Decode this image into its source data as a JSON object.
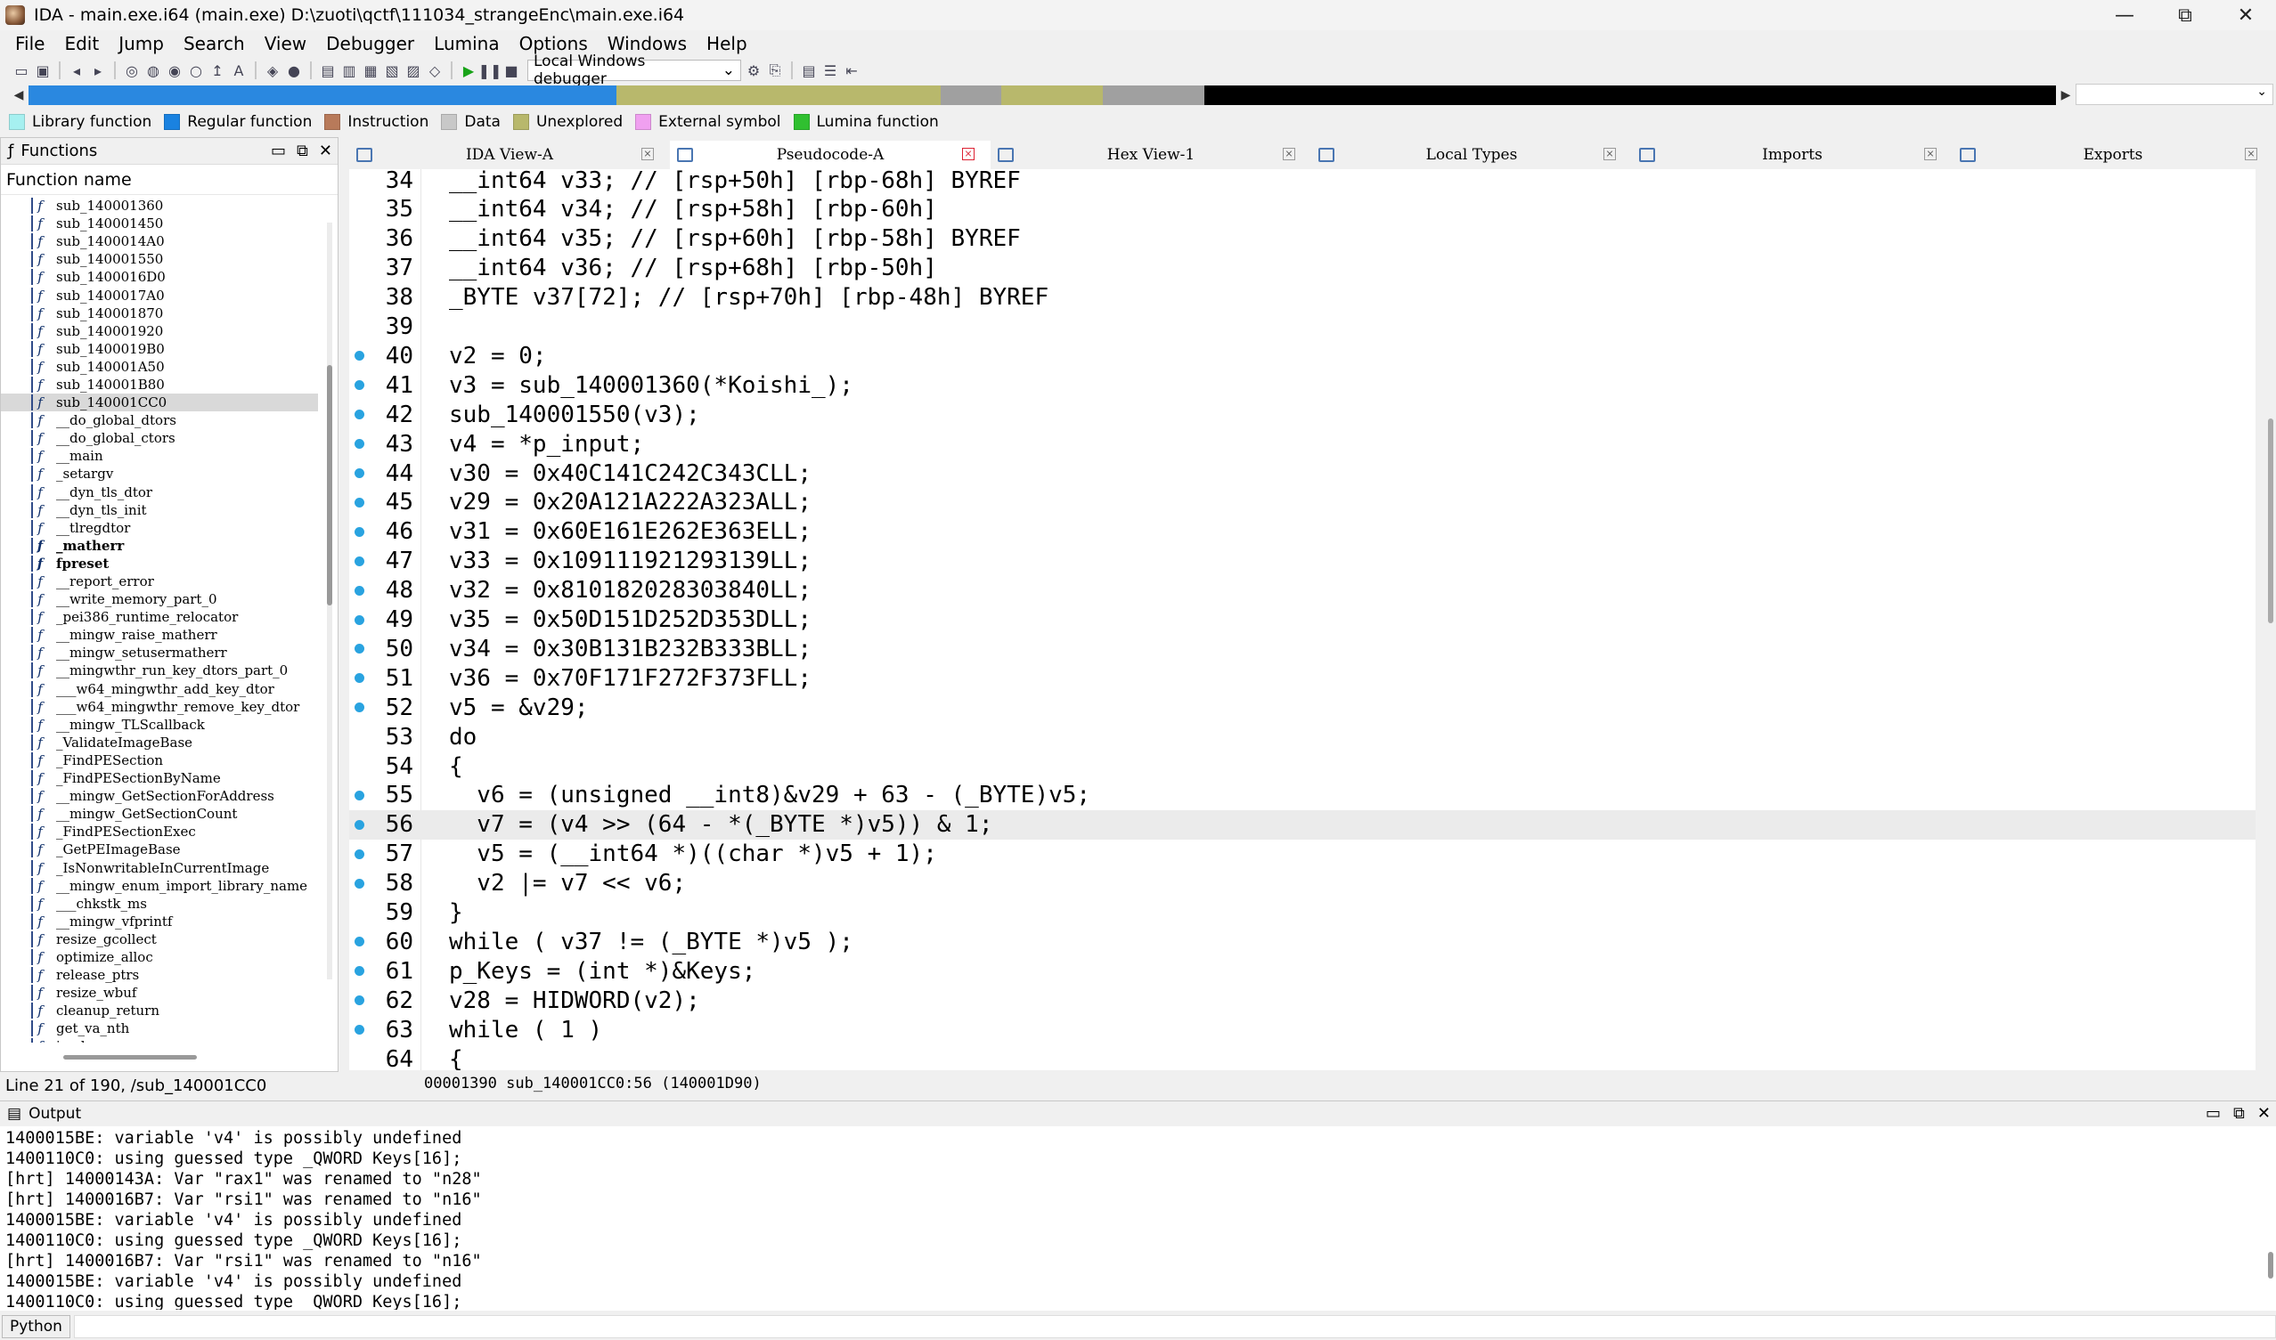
{
  "window": {
    "title": "IDA - main.exe.i64 (main.exe) D:\\zuoti\\qctf\\111034_strangeEnc\\main.exe.i64",
    "minimize": "—",
    "maximize": "⧉",
    "close": "✕"
  },
  "menu": [
    "File",
    "Edit",
    "Jump",
    "Search",
    "View",
    "Debugger",
    "Lumina",
    "Options",
    "Windows",
    "Help"
  ],
  "toolbar": {
    "debugger_select": "Local Windows debugger"
  },
  "navband": {
    "segments": [
      {
        "color": "#2a88e0",
        "fraction": 0.29
      },
      {
        "color": "#b8b86c",
        "fraction": 0.16
      },
      {
        "color": "#a0a0a0",
        "fraction": 0.03
      },
      {
        "color": "#b8b86c",
        "fraction": 0.05
      },
      {
        "color": "#a0a0a0",
        "fraction": 0.05
      },
      {
        "color": "#000000",
        "fraction": 0.42
      }
    ]
  },
  "legend": [
    {
      "label": "Library function",
      "color": "#a6f0f0"
    },
    {
      "label": "Regular function",
      "color": "#1a82e0"
    },
    {
      "label": "Instruction",
      "color": "#b87a5a"
    },
    {
      "label": "Data",
      "color": "#c8c8c8"
    },
    {
      "label": "Unexplored",
      "color": "#b8b86c"
    },
    {
      "label": "External symbol",
      "color": "#f0a0f0"
    },
    {
      "label": "Lumina function",
      "color": "#30c030"
    }
  ],
  "functions": {
    "panel_title": "Functions",
    "column_header": "Function name",
    "items": [
      {
        "name": "sub_140001360"
      },
      {
        "name": "sub_140001450"
      },
      {
        "name": "sub_1400014A0"
      },
      {
        "name": "sub_140001550"
      },
      {
        "name": "sub_1400016D0"
      },
      {
        "name": "sub_1400017A0"
      },
      {
        "name": "sub_140001870"
      },
      {
        "name": "sub_140001920"
      },
      {
        "name": "sub_1400019B0"
      },
      {
        "name": "sub_140001A50"
      },
      {
        "name": "sub_140001B80"
      },
      {
        "name": "sub_140001CC0",
        "selected": true
      },
      {
        "name": "__do_global_dtors"
      },
      {
        "name": "__do_global_ctors"
      },
      {
        "name": "__main"
      },
      {
        "name": "_setargv"
      },
      {
        "name": "__dyn_tls_dtor"
      },
      {
        "name": "__dyn_tls_init"
      },
      {
        "name": "__tlregdtor"
      },
      {
        "name": "_matherr",
        "bold": true
      },
      {
        "name": "fpreset",
        "bold": true
      },
      {
        "name": "__report_error"
      },
      {
        "name": "__write_memory_part_0"
      },
      {
        "name": "_pei386_runtime_relocator"
      },
      {
        "name": "__mingw_raise_matherr"
      },
      {
        "name": "__mingw_setusermatherr"
      },
      {
        "name": "__mingwthr_run_key_dtors_part_0"
      },
      {
        "name": "___w64_mingwthr_add_key_dtor"
      },
      {
        "name": "___w64_mingwthr_remove_key_dtor"
      },
      {
        "name": "__mingw_TLScallback"
      },
      {
        "name": "_ValidateImageBase"
      },
      {
        "name": "_FindPESection"
      },
      {
        "name": "_FindPESectionByName"
      },
      {
        "name": "__mingw_GetSectionForAddress"
      },
      {
        "name": "__mingw_GetSectionCount"
      },
      {
        "name": "_FindPESectionExec"
      },
      {
        "name": "_GetPEImageBase"
      },
      {
        "name": "_IsNonwritableInCurrentImage"
      },
      {
        "name": "__mingw_enum_import_library_name"
      },
      {
        "name": "___chkstk_ms"
      },
      {
        "name": "__mingw_vfprintf"
      },
      {
        "name": "resize_gcollect"
      },
      {
        "name": "optimize_alloc"
      },
      {
        "name": "release_ptrs"
      },
      {
        "name": "resize_wbuf"
      },
      {
        "name": "cleanup_return"
      },
      {
        "name": "get_va_nth"
      },
      {
        "name": "is_sh"
      }
    ],
    "status": "Line 21 of 190, /sub_140001CC0"
  },
  "tabs": [
    {
      "label": "IDA View-A",
      "active": false
    },
    {
      "label": "Pseudocode-A",
      "active": true
    },
    {
      "label": "Hex View-1",
      "active": false
    },
    {
      "label": "Local Types",
      "active": false
    },
    {
      "label": "Imports",
      "active": false
    },
    {
      "label": "Exports",
      "active": false
    }
  ],
  "code": {
    "lines": [
      {
        "num": "34",
        "bp": false,
        "text": "__int64 v33; // [rsp+50h] [rbp-68h] BYREF"
      },
      {
        "num": "35",
        "bp": false,
        "text": "__int64 v34; // [rsp+58h] [rbp-60h]"
      },
      {
        "num": "36",
        "bp": false,
        "text": "__int64 v35; // [rsp+60h] [rbp-58h] BYREF"
      },
      {
        "num": "37",
        "bp": false,
        "text": "__int64 v36; // [rsp+68h] [rbp-50h]"
      },
      {
        "num": "38",
        "bp": false,
        "text": "_BYTE v37[72]; // [rsp+70h] [rbp-48h] BYREF"
      },
      {
        "num": "39",
        "bp": false,
        "text": ""
      },
      {
        "num": "40",
        "bp": true,
        "text": "v2 = 0;"
      },
      {
        "num": "41",
        "bp": true,
        "text": "v3 = sub_140001360(*Koishi_);"
      },
      {
        "num": "42",
        "bp": true,
        "text": "sub_140001550(v3);"
      },
      {
        "num": "43",
        "bp": true,
        "text": "v4 = *p_input;"
      },
      {
        "num": "44",
        "bp": true,
        "text": "v30 = 0x40C141C242C343CLL;"
      },
      {
        "num": "45",
        "bp": true,
        "text": "v29 = 0x20A121A222A323ALL;"
      },
      {
        "num": "46",
        "bp": true,
        "text": "v31 = 0x60E161E262E363ELL;"
      },
      {
        "num": "47",
        "bp": true,
        "text": "v33 = 0x109111921293139LL;"
      },
      {
        "num": "48",
        "bp": true,
        "text": "v32 = 0x810182028303840LL;"
      },
      {
        "num": "49",
        "bp": true,
        "text": "v35 = 0x50D151D252D353DLL;"
      },
      {
        "num": "50",
        "bp": true,
        "text": "v34 = 0x30B131B232B333BLL;"
      },
      {
        "num": "51",
        "bp": true,
        "text": "v36 = 0x70F171F272F373FLL;"
      },
      {
        "num": "52",
        "bp": true,
        "text": "v5 = &v29;"
      },
      {
        "num": "53",
        "bp": false,
        "text": "do"
      },
      {
        "num": "54",
        "bp": false,
        "text": "{"
      },
      {
        "num": "55",
        "bp": true,
        "text": "  v6 = (unsigned __int8)&v29 + 63 - (_BYTE)v5;"
      },
      {
        "num": "56",
        "bp": true,
        "text": "  v7 = (v4 >> (64 - *(_BYTE *)v5)) & 1;",
        "current": true
      },
      {
        "num": "57",
        "bp": true,
        "text": "  v5 = (__int64 *)((char *)v5 + 1);"
      },
      {
        "num": "58",
        "bp": true,
        "text": "  v2 |= v7 << v6;"
      },
      {
        "num": "59",
        "bp": false,
        "text": "}"
      },
      {
        "num": "60",
        "bp": true,
        "text": "while ( v37 != (_BYTE *)v5 );"
      },
      {
        "num": "61",
        "bp": true,
        "text": "p_Keys = (int *)&Keys;"
      },
      {
        "num": "62",
        "bp": true,
        "text": "v28 = HIDWORD(v2);"
      },
      {
        "num": "63",
        "bp": true,
        "text": "while ( 1 )"
      },
      {
        "num": "64",
        "bp": false,
        "text": "{"
      }
    ],
    "status": "00001390 sub_140001CC0:56 (140001D90)"
  },
  "output": {
    "title": "Output",
    "lines": [
      "1400015BE: variable 'v4' is possibly undefined",
      "1400110C0: using guessed type _QWORD Keys[16];",
      "[hrt] 14000143A: Var \"rax1\" was renamed to \"n28\"",
      "[hrt] 1400016B7: Var \"rsi1\" was renamed to \"n16\"",
      "1400015BE: variable 'v4' is possibly undefined",
      "1400110C0: using guessed type _QWORD Keys[16];",
      "[hrt] 1400016B7: Var \"rsi1\" was renamed to \"n16\"",
      "1400015BE: variable 'v4' is possibly undefined",
      "1400110C0: using guessed type _QWORD Keys[16];"
    ]
  },
  "python": {
    "button": "Python"
  }
}
